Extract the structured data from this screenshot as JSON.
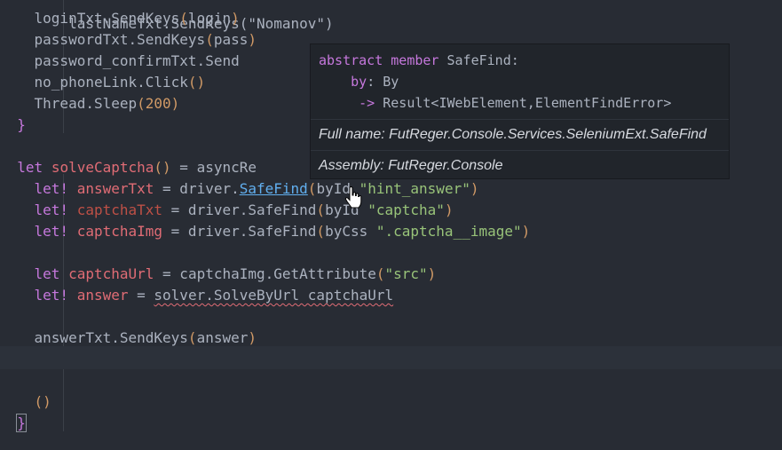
{
  "code": {
    "l0": {
      "text": "    lastNameTxt.SendKeys(\"Nomanov\")"
    },
    "l1": {
      "obj": "loginTxt.SendKeys",
      "arg": "login"
    },
    "l2": {
      "obj": "passwordTxt.SendKeys",
      "arg": "pass"
    },
    "l3": {
      "obj": "password_confirmTxt.Send"
    },
    "l4": {
      "obj": "no_phoneLink.Click",
      "parens": "()"
    },
    "l5": {
      "obj": "Thread.Sleep",
      "num": "200"
    },
    "l6": {
      "brace": "}"
    },
    "l8": {
      "kw": "let",
      "name": "solveCaptcha",
      "rest": " = asyncRe"
    },
    "l9": {
      "kw": "let!",
      "name": "answerTxt",
      "eq": " = driver.",
      "link": "SafeFind",
      "call": "byId ",
      "str": "\"hint_answer\""
    },
    "l10": {
      "kw": "let!",
      "name": "captchaTxt",
      "eq": " = driver.SafeFind",
      "call": "byId ",
      "str": "\"captcha\""
    },
    "l11": {
      "kw": "let!",
      "name": "captchaImg",
      "eq": " = driver.SafeFind",
      "call": "byCss ",
      "str": "\".captcha__image\""
    },
    "l13": {
      "kw": "let",
      "name": "captchaUrl",
      "eq": " = captchaImg.GetAttribute",
      "str": "\"src\""
    },
    "l14": {
      "kw": "let!",
      "name": "answer",
      "eq": " = ",
      "squiggle": "solver.SolveByUrl captchaUrl"
    },
    "l16": {
      "obj": "answerTxt.SendKeys",
      "arg": "answer"
    },
    "l19": {
      "parens": "()"
    },
    "l20": {
      "brace": "}"
    }
  },
  "tooltip": {
    "sig_kw": "abstract member",
    "sig_name": " SafeFind:",
    "by_label": "by",
    "by_type": " By",
    "arrow": "->",
    "result_type": " Result<IWebElement,ElementFindError>",
    "full_name": "Full name: FutReger.Console.Services.SeleniumExt.SafeFind",
    "assembly": "Assembly: FutReger.Console"
  },
  "colors": {
    "background": "#282c34",
    "keyword": "#c678dd",
    "variable": "#e06c75",
    "string": "#98c379",
    "number": "#d19a66",
    "link": "#61afef"
  }
}
